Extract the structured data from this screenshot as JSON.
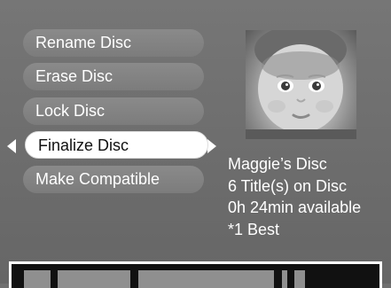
{
  "menu": {
    "items": [
      {
        "label": "Rename Disc"
      },
      {
        "label": "Erase Disc"
      },
      {
        "label": "Lock Disc"
      },
      {
        "label": "Finalize Disc"
      },
      {
        "label": "Make Compatible"
      }
    ],
    "selected_index": 3
  },
  "disc_info": {
    "name": "Maggie’s Disc",
    "titles": "6 Title(s) on Disc",
    "available": "0h 24min available",
    "quality": "*1 Best"
  },
  "thumbnail": {
    "icon": "disc-preview-thumbnail"
  },
  "colors": {
    "background": "#6f6f6f",
    "menu_item": "#848484",
    "selected": "#ffffff",
    "timeline_bg": "#111111",
    "timeline_segment": "#8f8f8f"
  }
}
